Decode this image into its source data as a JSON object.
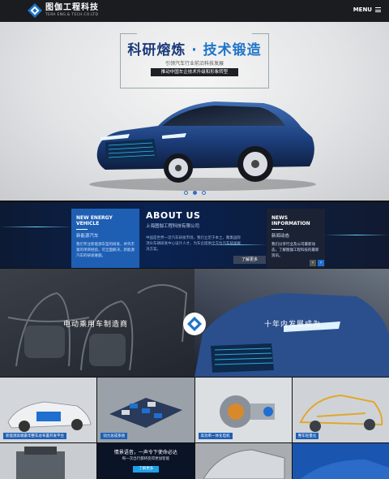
{
  "header": {
    "logo_cn": "图伽工程科技",
    "logo_en": "TERA ENG.& TECH.CO.LTD",
    "menu_label": "MENU"
  },
  "hero": {
    "title_part1": "科研熔炼",
    "title_sep": " · ",
    "title_part2": "技术锻造",
    "subtitle": "引领汽车行业前沿科技发展",
    "tagline": "推动中国车企技术升级和形象转型",
    "slides": 3,
    "active_slide": 2
  },
  "news_strip": {
    "card_left": {
      "title": "NEW ENERGY VEHICLE",
      "subtitle": "新能源汽车",
      "body": "我们专注新能源车型的研发，并凭丰富的项目经验，可全面解决，新能源汽车的研发难题。"
    },
    "about": {
      "title": "ABOUT US",
      "subtitle": "上海图伽工程科技有限公司",
      "body": "中国是世界一流汽车研发市场，我们立足于本土，聚集国际顶尖车辆研发中心设计人才，为车企提供全方位汽车研发解决方案。",
      "more_label": "了解更多"
    },
    "card_right": {
      "title": "NEWS INFORMATION",
      "subtitle": "新闻动态",
      "body": "我们分享行业及公司最新动态，了解图伽工程科技的最新资讯。"
    },
    "prev_label": "‹",
    "next_label": "›"
  },
  "dual_banner": {
    "left_text": "电动乘用车制造商",
    "right_text": "十年内发展成为"
  },
  "products": [
    {
      "label": "新能源高端豪华整车总布置开发平台"
    },
    {
      "label": "动力总成系统"
    },
    {
      "label": "高功率一体化电机"
    },
    {
      "label": "整车轻量化"
    }
  ],
  "row2": {
    "promo_line1": "情景语音，一声令下使命必达",
    "promo_line2": "每一次出行都将变得更加智能",
    "promo_badge": "了解更多"
  },
  "colors": {
    "brand_blue": "#1e5fb4",
    "accent_blue": "#1e74c8",
    "header_bg": "#1b1c1f"
  }
}
